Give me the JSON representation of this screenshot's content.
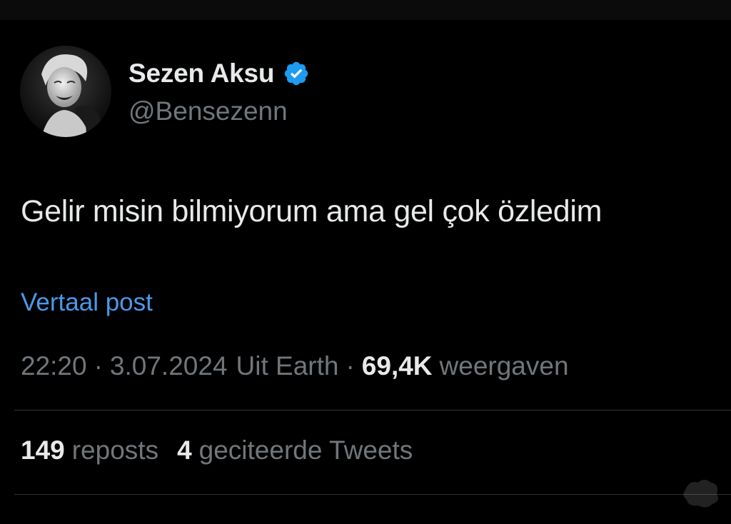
{
  "author": {
    "display_name": "Sezen Aksu",
    "handle": "@Bensezenn",
    "verified_color": "#1d9bf0"
  },
  "tweet": {
    "text": "Gelir misin bilmiyorum ama gel çok özledim",
    "translate_label": "Vertaal post"
  },
  "meta": {
    "time": "22:20",
    "date": "3.07.2024",
    "location": "Uit Earth",
    "separator": "·",
    "views_count": "69,4K",
    "views_label": "weergaven"
  },
  "stats": {
    "reposts_count": "149",
    "reposts_label": "reposts",
    "quotes_count": "4",
    "quotes_label": "geciteerde Tweets"
  },
  "colors": {
    "background": "#000000",
    "primary_text": "#e7e9ea",
    "secondary_text": "#71767b",
    "link": "#4a99e9",
    "divider": "#2f3336"
  }
}
